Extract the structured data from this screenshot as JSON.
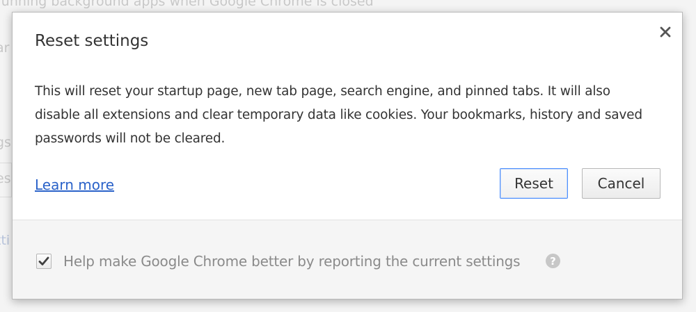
{
  "background": {
    "line1": "running background apps when Google Chrome is closed",
    "line2": "ar",
    "line3": "gs",
    "line4": "es",
    "line5": "tti"
  },
  "dialog": {
    "title": "Reset settings",
    "close_icon": "close-icon",
    "message": "This will reset your startup page, new tab page, search engine, and pinned tabs. It will also disable all extensions and clear temporary data like cookies. Your bookmarks, history and saved passwords will not be cleared.",
    "learn_more": "Learn more",
    "reset_label": "Reset",
    "cancel_label": "Cancel",
    "footer": {
      "checkbox_checked": true,
      "label": "Help make Google Chrome better by reporting the current settings",
      "help_icon": "question-icon",
      "help_glyph": "?"
    }
  },
  "colors": {
    "link": "#2a62c9",
    "reset_border": "#4d90fe",
    "footer_background": "#f5f5f5"
  }
}
